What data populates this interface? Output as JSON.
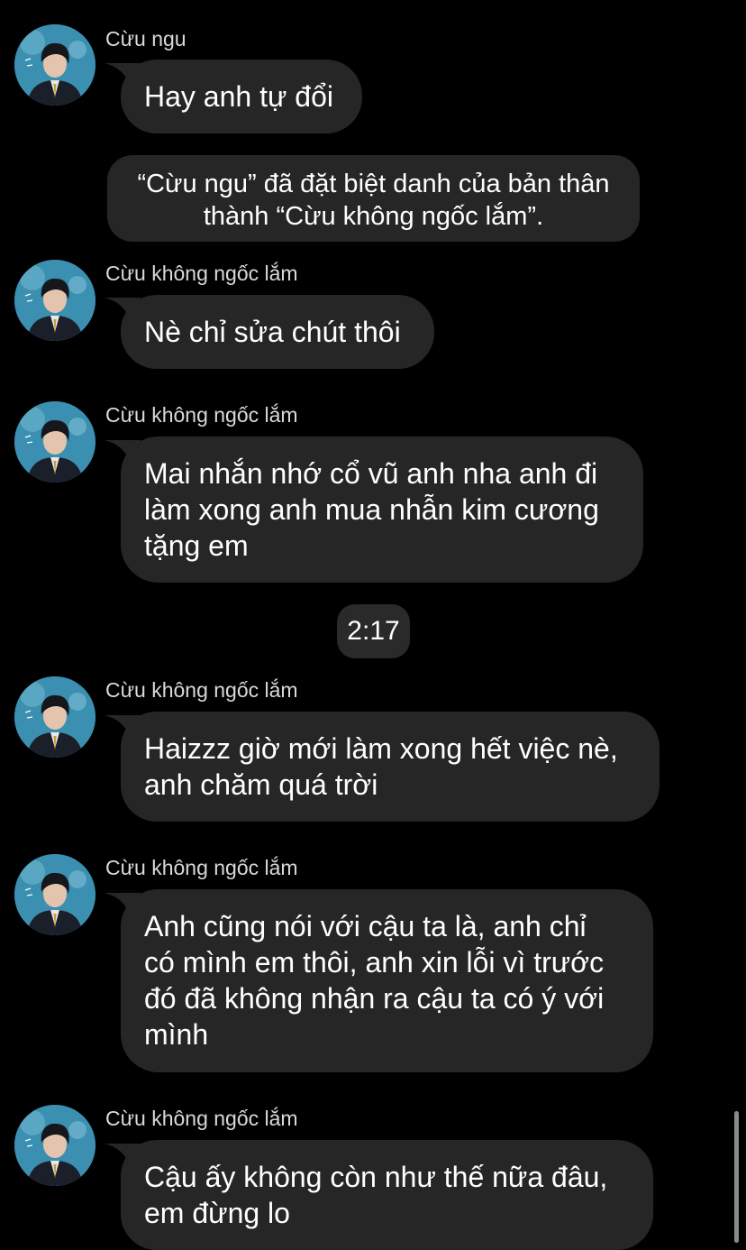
{
  "system_message": {
    "line1": "“Cừu ngu” đã đặt biệt danh của bản thân",
    "line2": "thành “Cừu không ngốc lắm”."
  },
  "timestamp": "2:17",
  "messages": [
    {
      "sender": "Cừu ngu",
      "text": "Hay anh tự đổi"
    },
    {
      "sender": "Cừu không ngốc lắm",
      "text": "Nè chỉ sửa chút thôi"
    },
    {
      "sender": "Cừu không ngốc lắm",
      "text": "Mai nhắn nhớ cổ vũ anh nha anh đi\nlàm xong anh mua nhẫn kim cương\ntặng em"
    },
    {
      "sender": "Cừu không ngốc lắm",
      "text": "Haizzz giờ mới làm xong hết việc nè,\nanh chăm quá trời"
    },
    {
      "sender": "Cừu không ngốc lắm",
      "text": "Anh cũng nói với cậu ta là, anh chỉ\ncó mình em thôi, anh xin lỗi vì trước\nđó đã không nhận ra cậu ta có ý với\nmình"
    },
    {
      "sender": "Cừu không ngốc lắm",
      "text": "Cậu ấy không còn như thế nữa đâu,\nem đừng lo"
    }
  ],
  "colors": {
    "background": "#000000",
    "bubble": "#262626",
    "text": "#ffffff",
    "sender": "#d9d9d9"
  },
  "icons": {
    "avatar": "profile-avatar"
  }
}
